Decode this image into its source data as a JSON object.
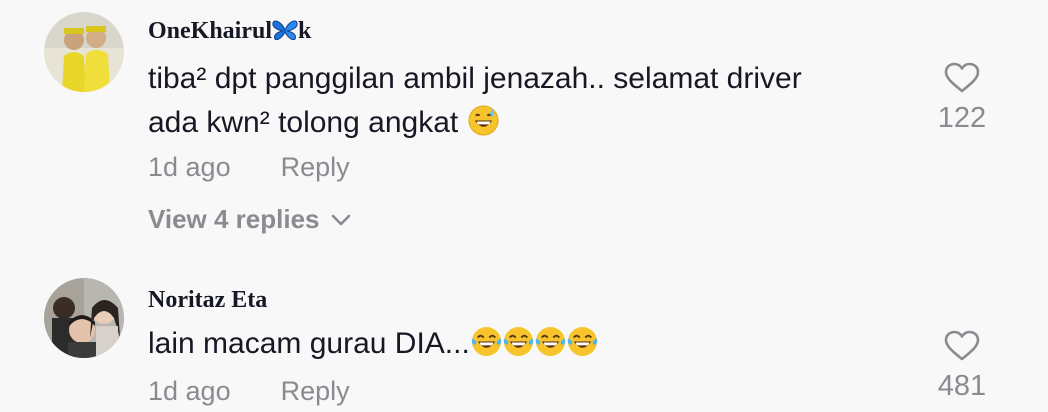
{
  "comments": [
    {
      "username": "OneKhairul",
      "username_suffix": "k",
      "username_icon": "blue-butterfly-icon",
      "text_lines": [
        "tiba² dpt panggilan ambil jenazah.. selamat driver",
        "ada kwn² tolong angkat"
      ],
      "text_emoji": "grinning-sweat-emoji",
      "time": "1d ago",
      "reply_label": "Reply",
      "like_count": "122",
      "view_replies_label": "View 4 replies"
    },
    {
      "username": "Noritaz Eta",
      "text_lines": [
        "lain macam gurau DIA..."
      ],
      "text_emoji": "tears-of-joy-emoji",
      "text_emoji_count": 4,
      "time": "1d ago",
      "reply_label": "Reply",
      "like_count": "481"
    }
  ],
  "colors": {
    "background": "#f8f8f8",
    "primary_text": "#161823",
    "secondary_text": "#8a8b91"
  }
}
